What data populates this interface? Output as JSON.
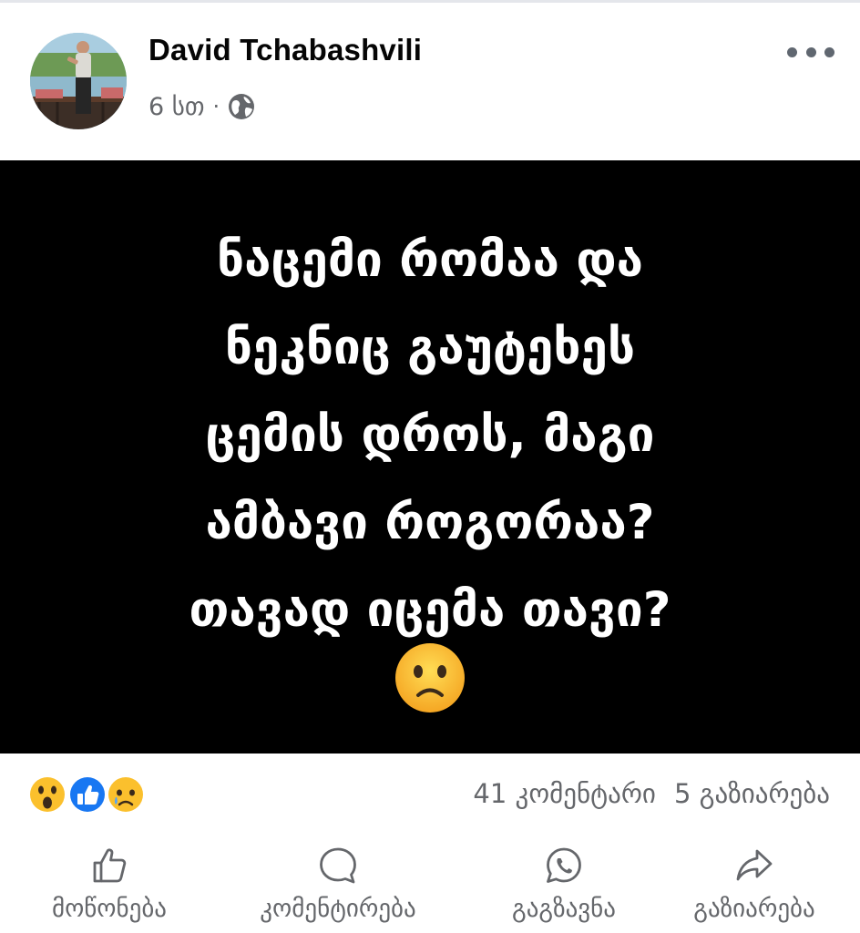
{
  "post": {
    "author": "David Tchabashvili",
    "time": "6 სთ",
    "separator": "·",
    "privacy_icon": "globe-icon",
    "text": "ნაცემი რომაა და\nნეკნიც გაუტეხეს\nცემის დროს, მაგი\nამბავი როგორაა?\nთავად იცემა თავი?",
    "image_emoji": "slightly-frowning-face"
  },
  "reactions": {
    "icons": [
      "wow-reaction-icon",
      "like-reaction-icon",
      "sad-reaction-icon"
    ],
    "comments": "41 კომენტარი",
    "shares": "5 გაზიარება"
  },
  "actions": {
    "like": "მოწონება",
    "comment": "კომენტირება",
    "send": "გაგზავნა",
    "share": "გაზიარება"
  },
  "colors": {
    "secondary_text": "#65676b",
    "like_blue": "#1877f2",
    "image_background": "#000000",
    "emoji_yellow": "#fbcb3d"
  }
}
